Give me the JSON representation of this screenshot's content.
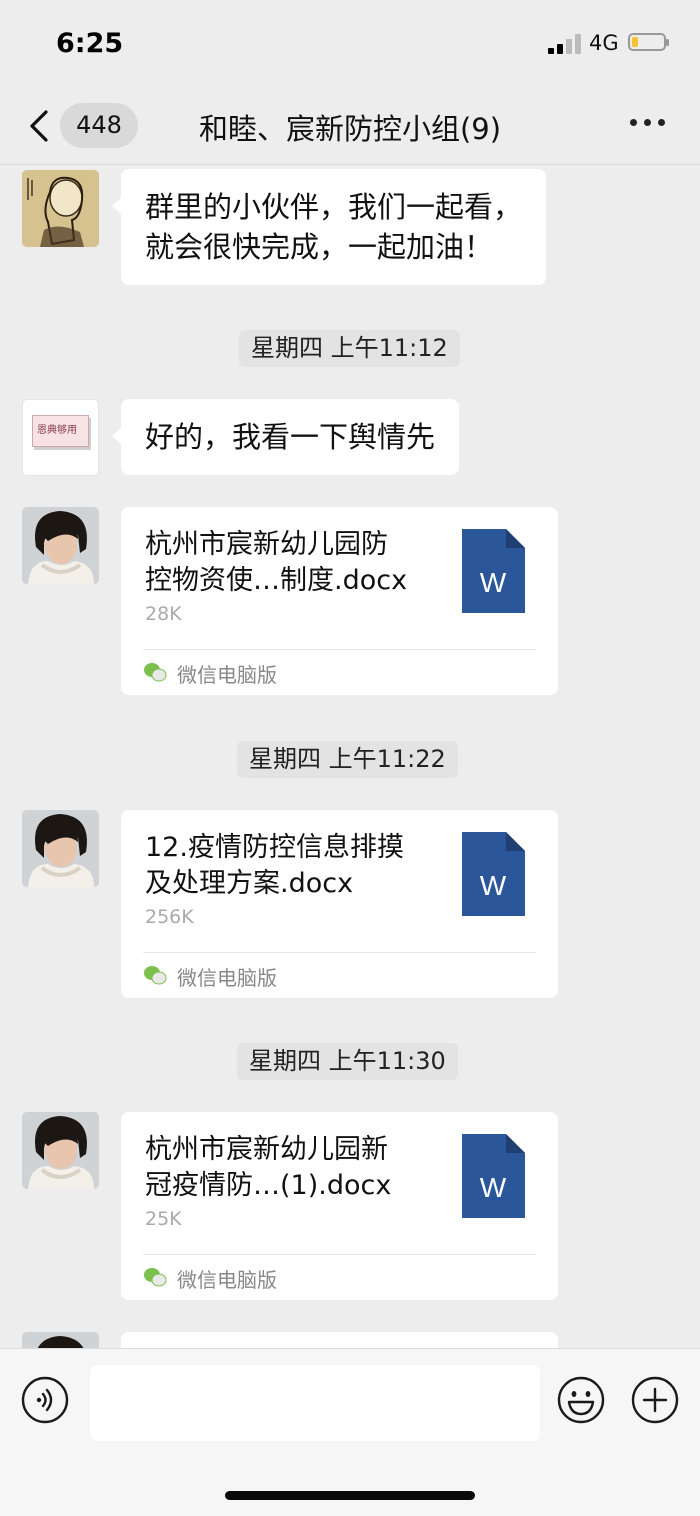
{
  "status_bar": {
    "time": "6:25",
    "network": "4G",
    "battery_level": 0.2
  },
  "nav": {
    "unread_count": "448",
    "title": "和睦、宸新防控小组(9)"
  },
  "messages": [
    {
      "type": "text",
      "avatar": "sketch-portrait-avatar",
      "lines": [
        "群里的小伙伴，我们一起看，",
        "就会很快完成，一起加油！"
      ]
    },
    {
      "type": "time",
      "text": "星期四 上午11:12"
    },
    {
      "type": "text",
      "avatar": "card-avatar",
      "avatar_text": "恩典够用",
      "lines": [
        "好的，我看一下舆情先"
      ]
    },
    {
      "type": "file",
      "avatar": "woman-photo-avatar",
      "name_lines": [
        "杭州市宸新幼儿园防",
        "控物资使…制度.docx"
      ],
      "size": "28K",
      "source": "微信电脑版",
      "icon_letter": "W"
    },
    {
      "type": "time",
      "text": "星期四 上午11:22"
    },
    {
      "type": "file",
      "avatar": "woman-photo-avatar",
      "name_lines": [
        "12.疫情防控信息排摸",
        "及处理方案.docx"
      ],
      "size": "256K",
      "source": "微信电脑版",
      "icon_letter": "W"
    },
    {
      "type": "time",
      "text": "星期四 上午11:30"
    },
    {
      "type": "file",
      "avatar": "woman-photo-avatar",
      "name_lines": [
        "杭州市宸新幼儿园新",
        "冠疫情防…(1).docx"
      ],
      "size": "25K",
      "source": "微信电脑版",
      "icon_letter": "W"
    }
  ],
  "input": {
    "value": "",
    "placeholder": ""
  },
  "colors": {
    "background": "#ededed",
    "bubble": "#ffffff",
    "word_icon": "#2b579a",
    "wechat_green": "#7bbf4c"
  }
}
